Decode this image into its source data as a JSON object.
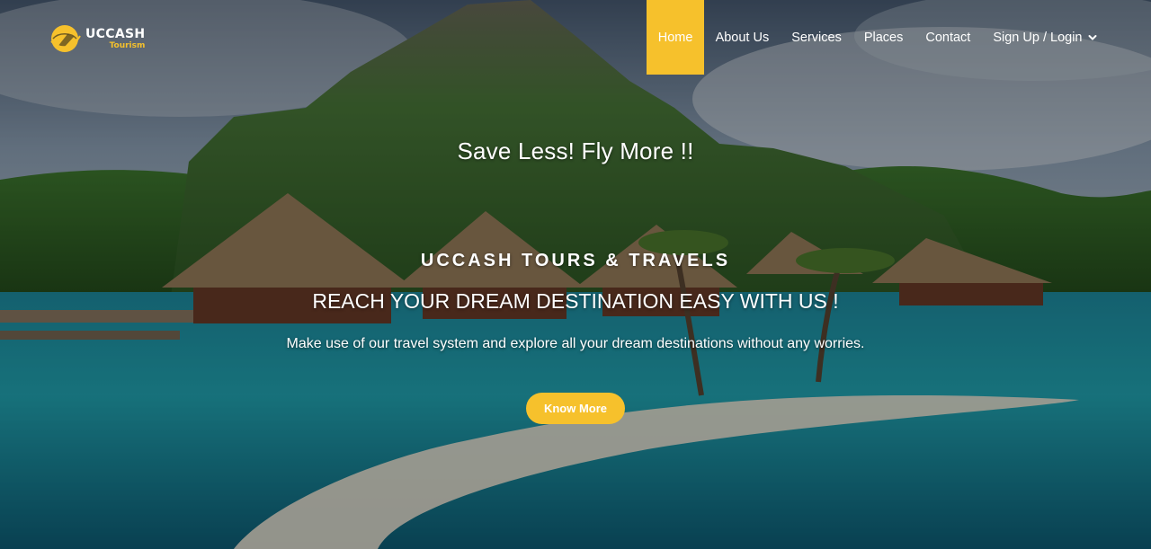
{
  "brand": {
    "logo_title": "UCCASH",
    "logo_subtitle": "Tourism",
    "accent_color": "#f6c12c"
  },
  "nav": {
    "items": [
      {
        "label": "Home",
        "active": true
      },
      {
        "label": "About Us"
      },
      {
        "label": "Services"
      },
      {
        "label": "Places"
      },
      {
        "label": "Contact"
      },
      {
        "label": "Sign Up / Login",
        "icon": "chevron-down-icon"
      }
    ]
  },
  "hero": {
    "tagline": "Save Less! Fly More !!",
    "company": "UCCASH TOURS & TRAVELS",
    "headline": "REACH YOUR DREAM DESTINATION EASY WITH US !",
    "description": "Make use of our travel system and explore all your dream destinations without any worries.",
    "cta_label": "Know More"
  }
}
